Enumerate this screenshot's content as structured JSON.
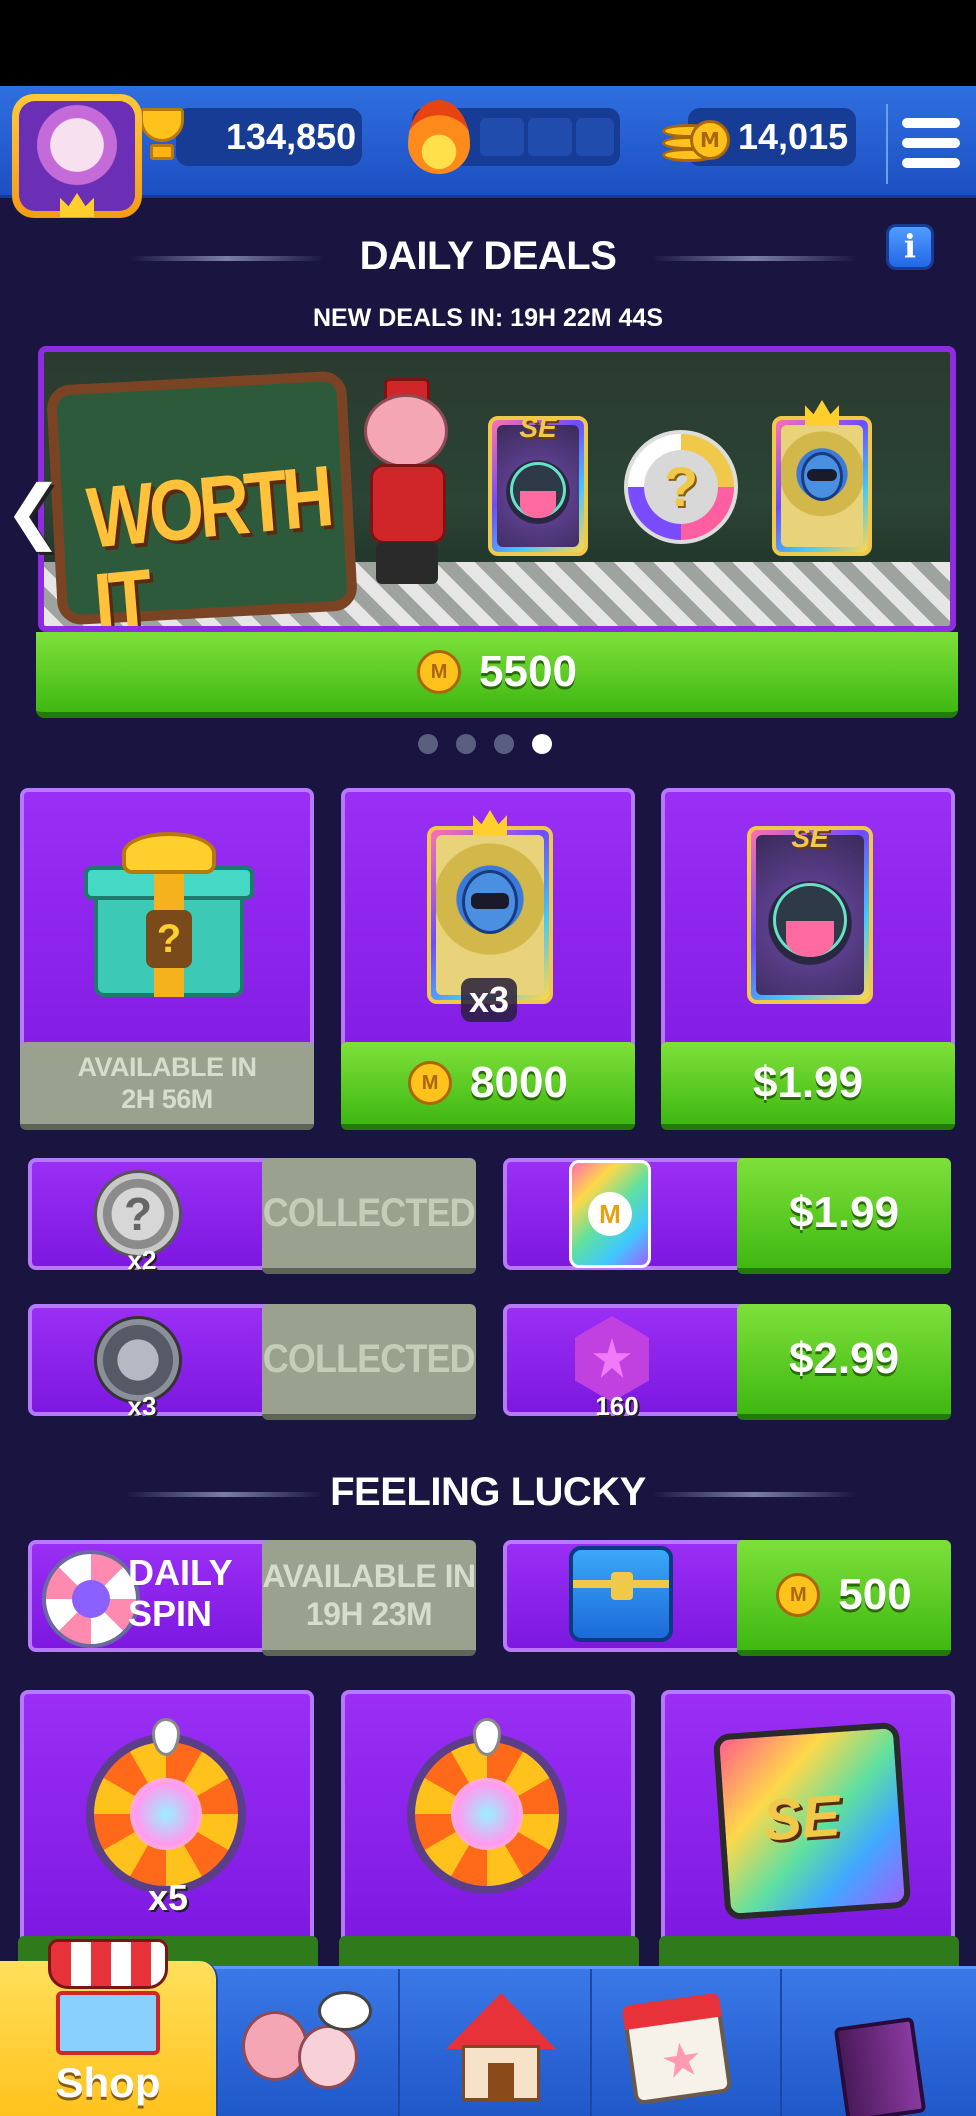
{
  "header": {
    "trophies": "134,850",
    "coins": "14,015",
    "icons": [
      "avatar",
      "trophy-icon",
      "flame-icon",
      "coins-icon",
      "menu-icon"
    ]
  },
  "daily_deals": {
    "title": "DAILY DEALS",
    "countdown": "NEW DEALS IN: 19H 22M 44S",
    "banner": {
      "sign_text": "WORTH IT",
      "card_tag": "SE",
      "price": "5500"
    },
    "carousel": {
      "pages": 4,
      "active_page": 4
    },
    "tiles": [
      {
        "name": "mystery-gift",
        "status_line1": "AVAILABLE IN",
        "status_line2": "2H 56M"
      },
      {
        "name": "hero-card",
        "multiplier": "x3",
        "price": "8000"
      },
      {
        "name": "se-card",
        "tag": "SE",
        "price": "$1.99"
      }
    ],
    "rows": [
      {
        "name": "mystery-token",
        "count": "x2",
        "status": "COLLECTED"
      },
      {
        "name": "m-card",
        "price": "$1.99",
        "coin_letter": "M"
      },
      {
        "name": "scarab-token",
        "count": "x3",
        "status": "COLLECTED"
      },
      {
        "name": "gem",
        "count": "160",
        "price": "$2.99"
      }
    ]
  },
  "feeling_lucky": {
    "title": "FEELING LUCKY",
    "daily_spin": {
      "label_line1": "DAILY",
      "label_line2": "SPIN",
      "status_line1": "AVAILABLE IN",
      "status_line2": "19H 23M"
    },
    "chest": {
      "price": "500"
    },
    "tiles": [
      {
        "name": "wheel-token-pack",
        "multiplier": "x5"
      },
      {
        "name": "wheel-token"
      },
      {
        "name": "se-box",
        "tag": "SE"
      }
    ]
  },
  "navbar": {
    "items": [
      {
        "id": "shop",
        "label": "Shop",
        "active": true
      },
      {
        "id": "friends"
      },
      {
        "id": "home"
      },
      {
        "id": "events"
      },
      {
        "id": "collection"
      }
    ]
  },
  "colors": {
    "background": "#1a1540",
    "tile_purple": "#8a22ea",
    "button_green": "#4fc81a",
    "button_gray": "#9aa18f",
    "topbar_blue": "#2a62d8",
    "coin_gold": "#ffc21c"
  }
}
